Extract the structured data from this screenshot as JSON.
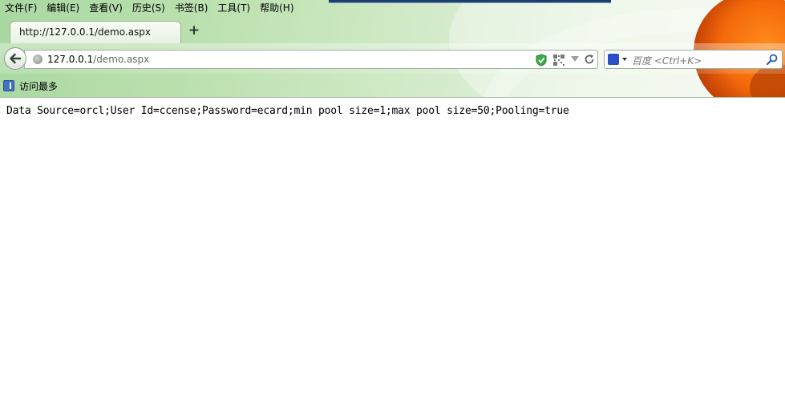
{
  "menu": [
    "文件(F)",
    "编辑(E)",
    "查看(V)",
    "历史(S)",
    "书签(B)",
    "工具(T)",
    "帮助(H)"
  ],
  "tab": {
    "title": "http://127.0.0.1/demo.aspx",
    "new_tab": "+"
  },
  "urlbar": {
    "host": "127.0.0.1",
    "path": "/demo.aspx"
  },
  "search": {
    "placeholder": "百度 <Ctrl+K>",
    "engine_icon": "baidu-paw-icon"
  },
  "bookmarks": {
    "label": "访问最多"
  },
  "page": {
    "text": "Data Source=orcl;User Id=ccense;Password=ecard;min pool size=1;max pool size=50;Pooling=true"
  }
}
